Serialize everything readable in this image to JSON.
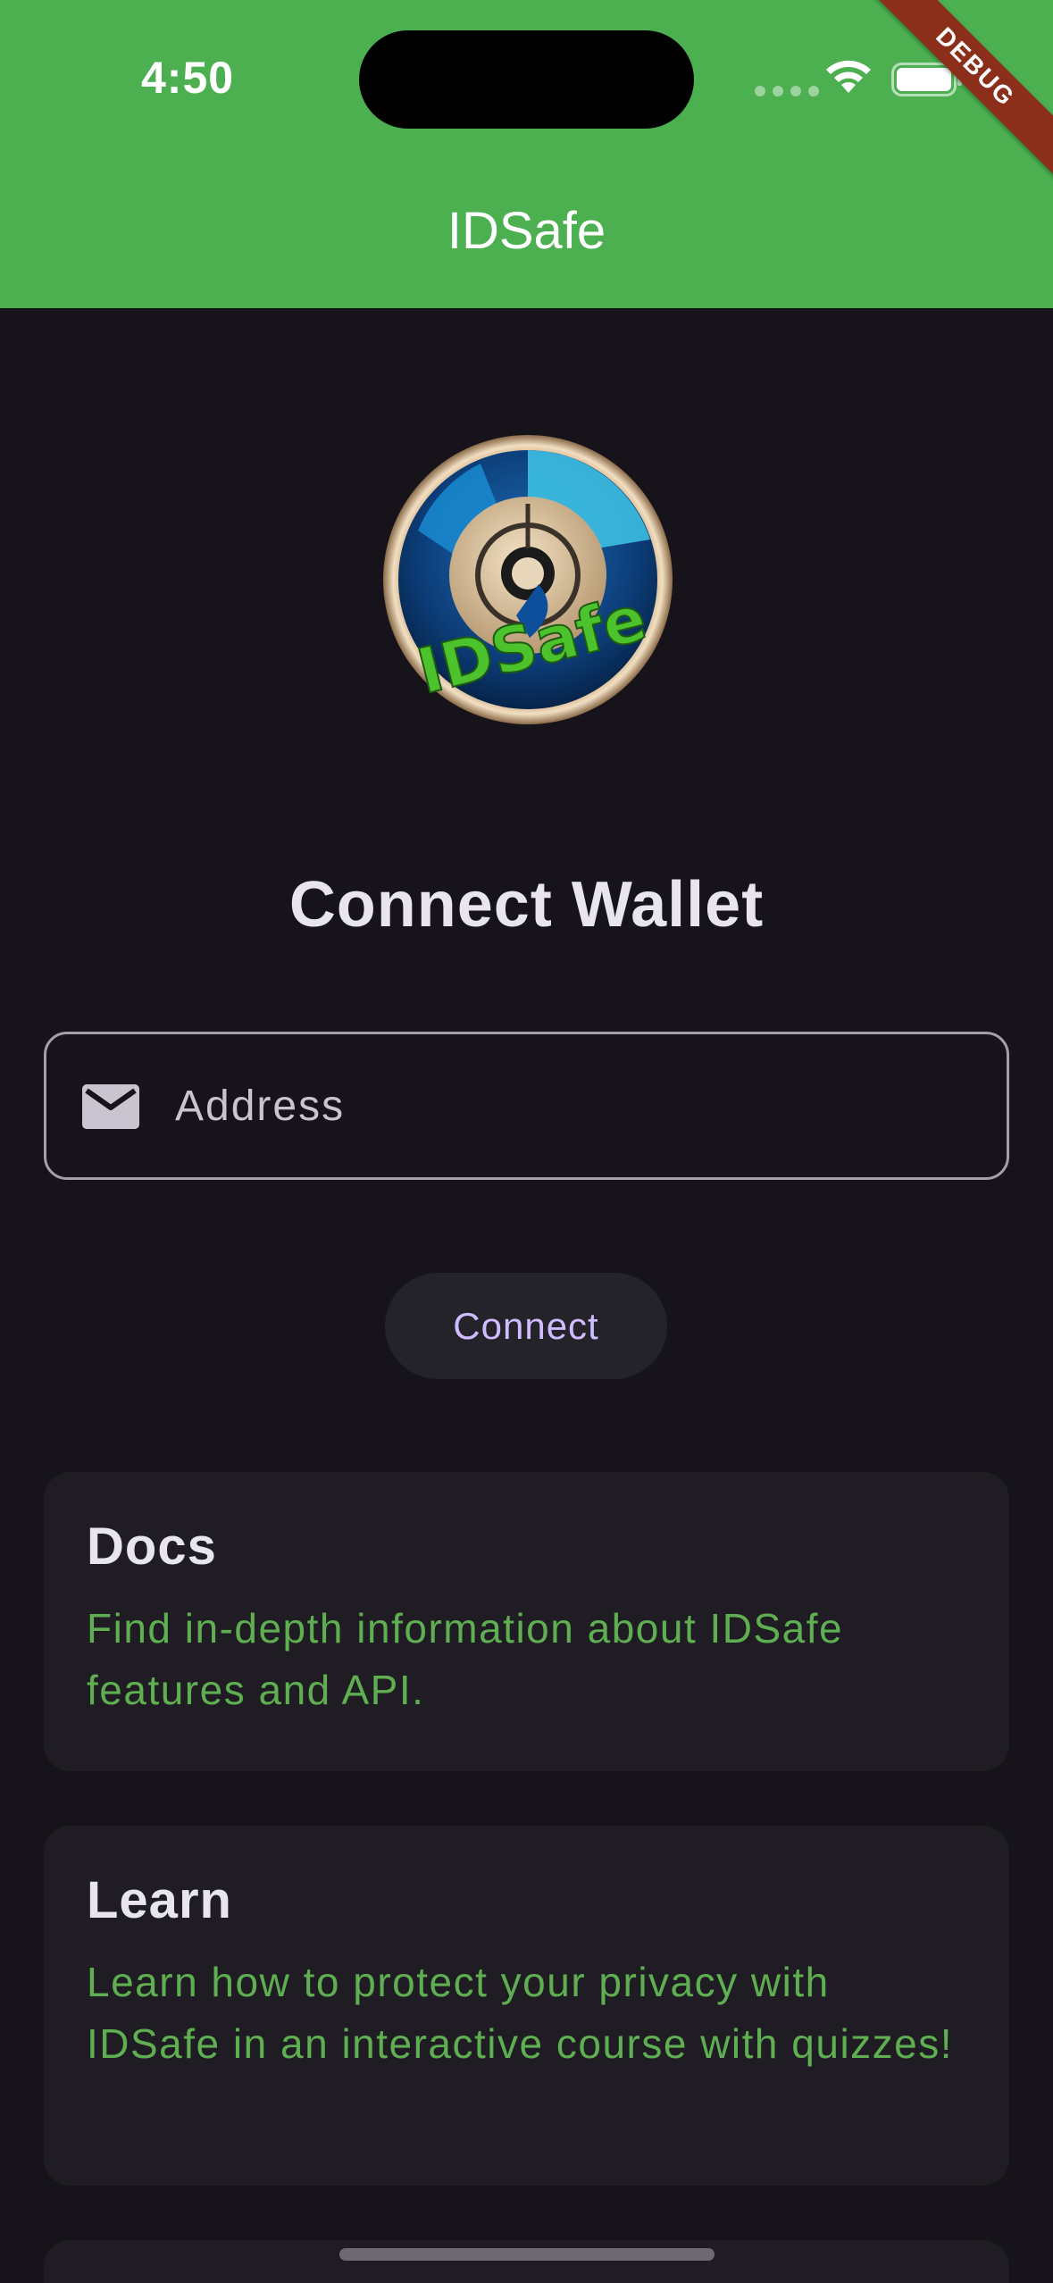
{
  "status_bar": {
    "time": "4:50",
    "icons": [
      "cellular-signal-icon",
      "wifi-icon",
      "battery-icon"
    ]
  },
  "debug_banner": "DEBUG",
  "app_bar": {
    "title": "IDSafe",
    "background_color": "#4caf50"
  },
  "logo": {
    "text": "IDSafe"
  },
  "connect": {
    "heading": "Connect Wallet",
    "address_placeholder": "Address",
    "address_icon": "mail-icon",
    "button_label": "Connect"
  },
  "cards": [
    {
      "title": "Docs",
      "description": "Find in-depth information about IDSafe features and API."
    },
    {
      "title": "Learn",
      "description": "Learn how to protect your privacy with IDSafe in an interactive course with quizzes!"
    }
  ],
  "colors": {
    "background": "#16141a",
    "card": "#1f1d23",
    "accent_green": "#5fae52",
    "button_text": "#cfbcff"
  }
}
